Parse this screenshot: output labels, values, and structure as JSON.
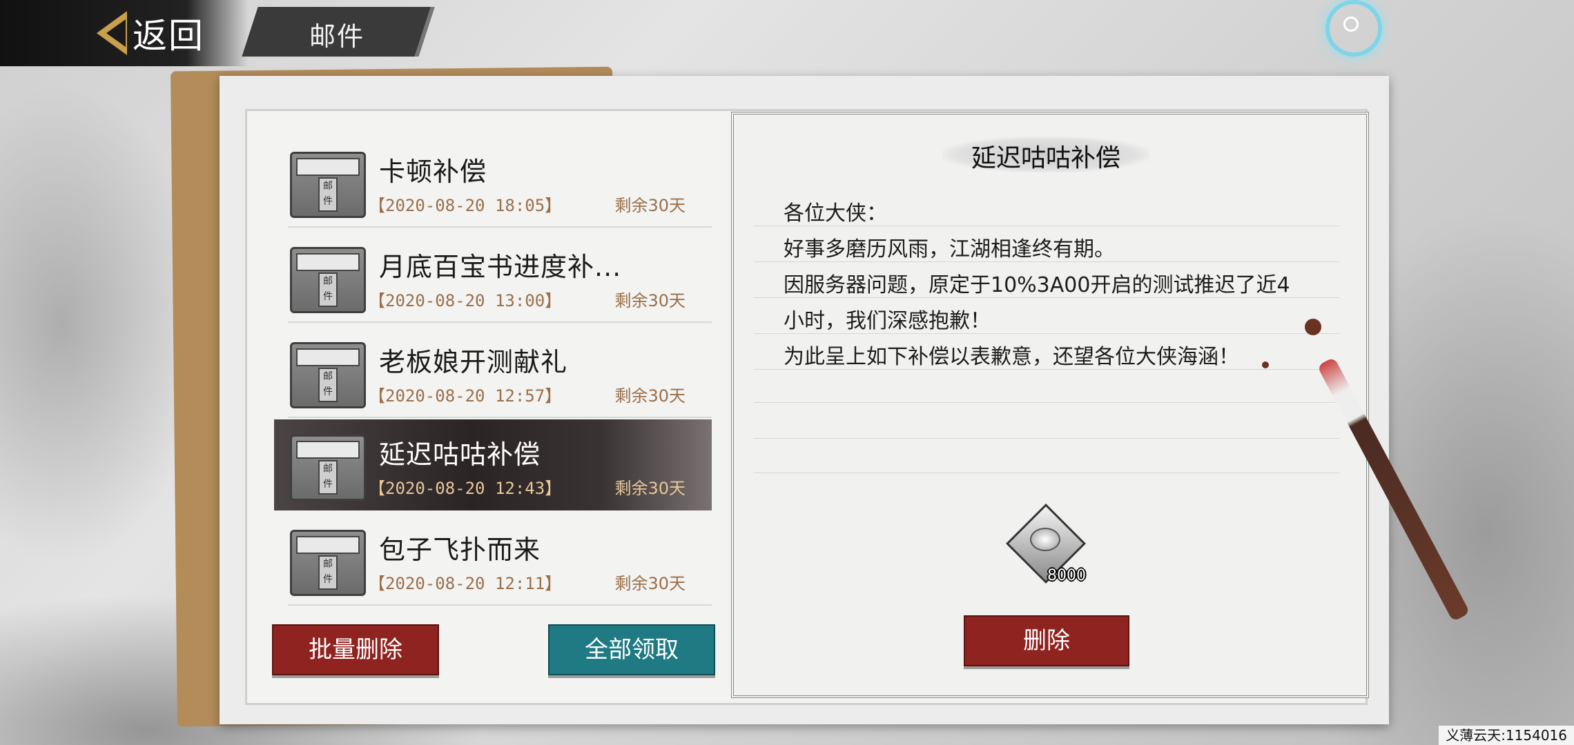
{
  "header": {
    "back_label": "返回",
    "title": "邮件"
  },
  "mail_list": [
    {
      "title": "卡顿补偿",
      "date": "【2020-08-20 18:05】",
      "remain": "剩余30天",
      "icon_tag": "邮件",
      "selected": false
    },
    {
      "title": "月底百宝书进度补...",
      "date": "【2020-08-20 13:00】",
      "remain": "剩余30天",
      "icon_tag": "邮件",
      "selected": false
    },
    {
      "title": "老板娘开测献礼",
      "date": "【2020-08-20 12:57】",
      "remain": "剩余30天",
      "icon_tag": "邮件",
      "selected": false
    },
    {
      "title": "延迟咕咕补偿",
      "date": "【2020-08-20 12:43】",
      "remain": "剩余30天",
      "icon_tag": "邮件",
      "selected": true
    },
    {
      "title": "包子飞扑而来",
      "date": "【2020-08-20 12:11】",
      "remain": "剩余30天",
      "icon_tag": "邮件",
      "selected": false
    }
  ],
  "actions": {
    "batch_delete": "批量删除",
    "claim_all": "全部领取"
  },
  "detail": {
    "title": "延迟咕咕补偿",
    "lines": [
      "各位大侠：",
      "好事多磨历风雨，江湖相逢终有期。",
      "因服务器问题，原定于10%3A00开启的测试推迟了近4",
      "小时，我们深感抱歉！",
      "为此呈上如下补偿以表歉意，还望各位大侠海涵！"
    ],
    "reward": {
      "icon": "silver-ingot-icon",
      "count": "8000"
    },
    "delete_label": "删除"
  },
  "footer": {
    "user_id": "义薄云天:1154016"
  },
  "colors": {
    "accent_red": "#8f2320",
    "accent_teal": "#1f7a84",
    "date_brown": "#9a6f4a",
    "back_gold": "#c8a04a"
  }
}
